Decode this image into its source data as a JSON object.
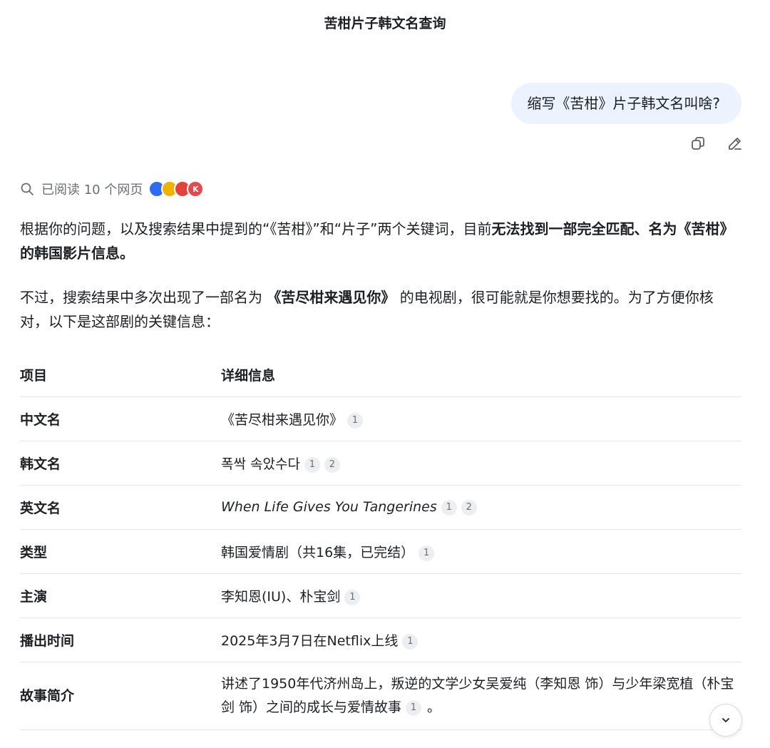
{
  "header": {
    "title": "苦柑片子韩文名查询"
  },
  "user_message": {
    "text": "缩写《苦柑》片子韩文名叫啥?"
  },
  "message_actions": {
    "copy_icon": "copy-icon",
    "edit_icon": "edit-icon"
  },
  "search_summary": {
    "text": "已阅读 10 个网页",
    "icon": "search-icon",
    "favicons": [
      {
        "color": "#2f6bf2"
      },
      {
        "color": "#f2b300"
      },
      {
        "color": "#e2433b"
      },
      {
        "color": "#e5484d",
        "letter": "K"
      }
    ]
  },
  "answer": {
    "p1_a": "根据你的问题，以及搜索结果中提到的“《苦柑》”和“片子”两个关键词，目前",
    "p1_b": "无法找到一部完全匹配、名为《苦柑》的韩国影片信息。",
    "p2_a": "不过，搜索结果中多次出现了一部名为 ",
    "p2_b": "《苦尽柑来遇见你》",
    "p2_c": " 的电视剧，很可能就是你想要找的。为了方便你核对，以下是这部剧的关键信息："
  },
  "table": {
    "headers": [
      "项目",
      "详细信息"
    ],
    "rows": [
      {
        "label": "中文名",
        "value": "《苦尽柑来遇见你》",
        "refs": [
          "1"
        ]
      },
      {
        "label": "韩文名",
        "value": "폭싹 속았수다",
        "refs": [
          "1",
          "2"
        ]
      },
      {
        "label": "英文名",
        "value": "When Life Gives You Tangerines",
        "refs": [
          "1",
          "2"
        ]
      },
      {
        "label": "类型",
        "value": "韩国爱情剧（共16集，已完结）",
        "refs": [
          "1"
        ]
      },
      {
        "label": "主演",
        "value": "李知恩(IU)、朴宝剑",
        "refs": [
          "1"
        ]
      },
      {
        "label": "播出时间",
        "value": "2025年3月7日在Netflix上线",
        "refs": [
          "1"
        ]
      },
      {
        "label": "故事简介",
        "value": "讲述了1950年代济州岛上，叛逆的文学少女吴爱纯（李知恩 饰）与少年梁宽植（朴宝剑 饰）之间的成长与爱情故事",
        "refs": [
          "1"
        ],
        "suffix": "。"
      }
    ]
  },
  "scroll_button": {
    "icon": "chevron-down-icon"
  }
}
